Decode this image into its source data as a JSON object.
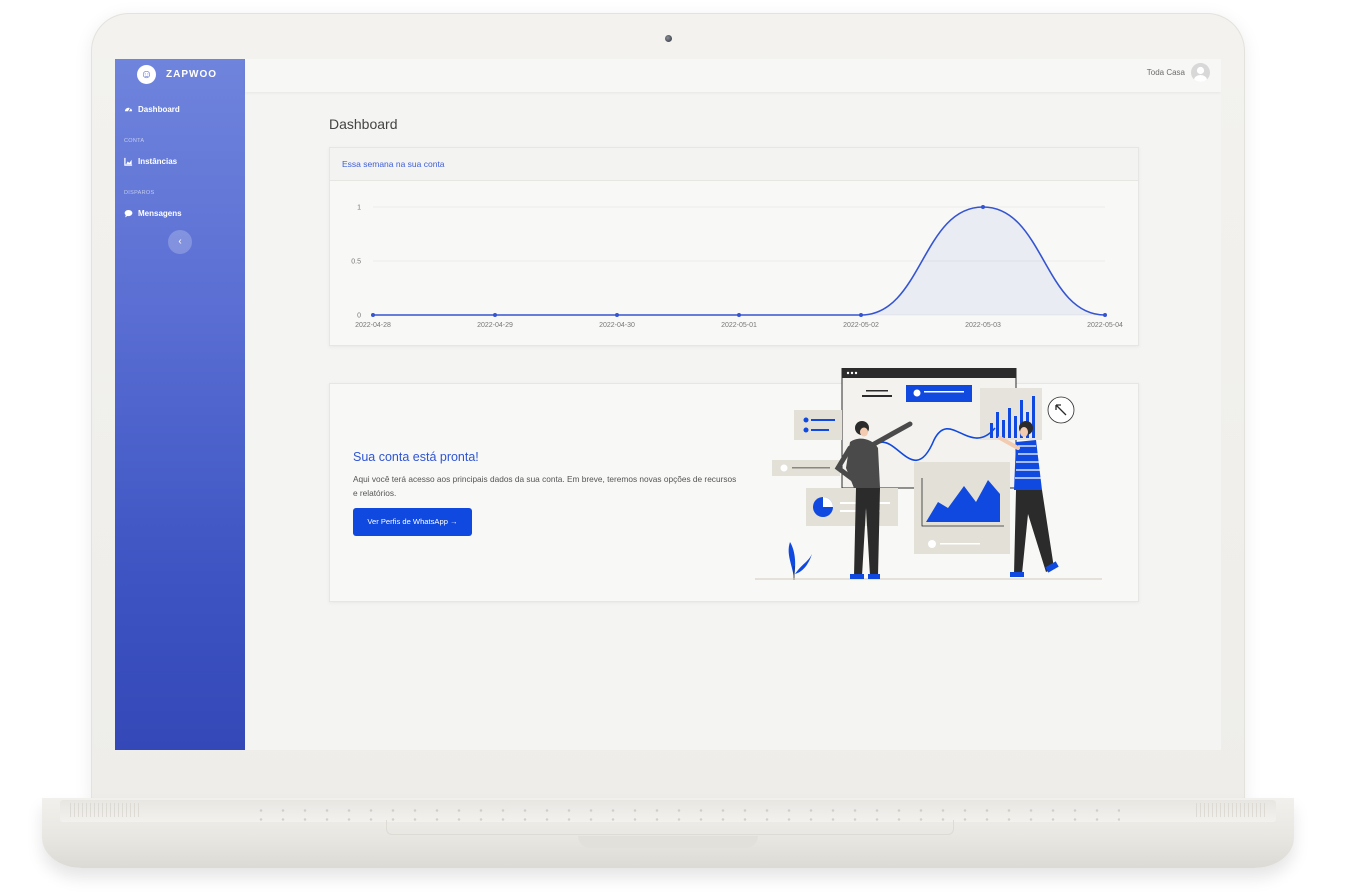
{
  "app": {
    "brand": "ZAPWOO"
  },
  "sidebar": {
    "items": [
      {
        "label": "Dashboard",
        "icon": "speedometer-icon"
      },
      {
        "section": "CONTA"
      },
      {
        "label": "Instâncias",
        "icon": "chart-icon"
      },
      {
        "section": "DISPAROS"
      },
      {
        "label": "Mensagens",
        "icon": "chat-icon"
      }
    ],
    "collapse_glyph": "‹"
  },
  "topbar": {
    "user_name": "Toda Casa"
  },
  "page": {
    "title": "Dashboard"
  },
  "chart_card": {
    "header": "Essa semana na sua conta"
  },
  "hero": {
    "title": "Sua conta está pronta!",
    "text": "Aqui você terá acesso aos principais dados da sua conta. Em breve, teremos novas opções de recursos e relatórios.",
    "button": "Ver Perfis de WhatsApp →"
  },
  "colors": {
    "primary": "#1049e0",
    "sidebar_top": "#6f84dc",
    "sidebar_bottom": "#3548b7",
    "line": "#3554d1"
  },
  "chart_data": {
    "type": "line",
    "title": "",
    "xlabel": "",
    "ylabel": "",
    "x": [
      "2022-04-28",
      "2022-04-29",
      "2022-04-30",
      "2022-05-01",
      "2022-05-02",
      "2022-05-03",
      "2022-05-04"
    ],
    "series": [
      {
        "values": [
          0,
          0,
          0,
          0,
          0,
          1,
          0
        ]
      }
    ],
    "yticks": [
      "0",
      "0.5",
      "1"
    ],
    "ylim": [
      0,
      1
    ],
    "grid": true,
    "smooth": true,
    "area_fill": true
  }
}
